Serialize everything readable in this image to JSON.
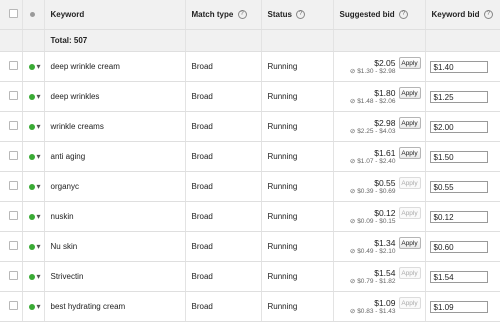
{
  "header": {
    "keyword": "Keyword",
    "match_type": "Match type",
    "status": "Status",
    "suggested_bid": "Suggested bid",
    "keyword_bid": "Keyword bid",
    "help_glyph": "?"
  },
  "total": {
    "label": "Total: 507"
  },
  "glyphs": {
    "status_menu": "▾",
    "range_icon": "⊘"
  },
  "rows": [
    {
      "keyword": "deep wrinkle cream",
      "match": "Broad",
      "status": "Running",
      "bid": "$2.05",
      "range": "$1.30 - $2.98",
      "apply": "Apply",
      "apply_enabled": true,
      "kbid": "$1.40"
    },
    {
      "keyword": "deep wrinkles",
      "match": "Broad",
      "status": "Running",
      "bid": "$1.80",
      "range": "$1.48 - $2.06",
      "apply": "Apply",
      "apply_enabled": true,
      "kbid": "$1.25"
    },
    {
      "keyword": "wrinkle creams",
      "match": "Broad",
      "status": "Running",
      "bid": "$2.98",
      "range": "$2.25 - $4.03",
      "apply": "Apply",
      "apply_enabled": true,
      "kbid": "$2.00"
    },
    {
      "keyword": "anti aging",
      "match": "Broad",
      "status": "Running",
      "bid": "$1.61",
      "range": "$1.07 - $2.40",
      "apply": "Apply",
      "apply_enabled": true,
      "kbid": "$1.50"
    },
    {
      "keyword": "organyc",
      "match": "Broad",
      "status": "Running",
      "bid": "$0.55",
      "range": "$0.39 - $0.69",
      "apply": "Apply",
      "apply_enabled": false,
      "kbid": "$0.55"
    },
    {
      "keyword": "nuskin",
      "match": "Broad",
      "status": "Running",
      "bid": "$0.12",
      "range": "$0.09 - $0.15",
      "apply": "Apply",
      "apply_enabled": false,
      "kbid": "$0.12"
    },
    {
      "keyword": "Nu skin",
      "match": "Broad",
      "status": "Running",
      "bid": "$1.34",
      "range": "$0.49 - $2.10",
      "apply": "Apply",
      "apply_enabled": true,
      "kbid": "$0.60"
    },
    {
      "keyword": "Strivectin",
      "match": "Broad",
      "status": "Running",
      "bid": "$1.54",
      "range": "$0.79 - $1.82",
      "apply": "Apply",
      "apply_enabled": false,
      "kbid": "$1.54"
    },
    {
      "keyword": "best hydrating cream",
      "match": "Broad",
      "status": "Running",
      "bid": "$1.09",
      "range": "$0.83 - $1.43",
      "apply": "Apply",
      "apply_enabled": false,
      "kbid": "$1.09"
    }
  ]
}
